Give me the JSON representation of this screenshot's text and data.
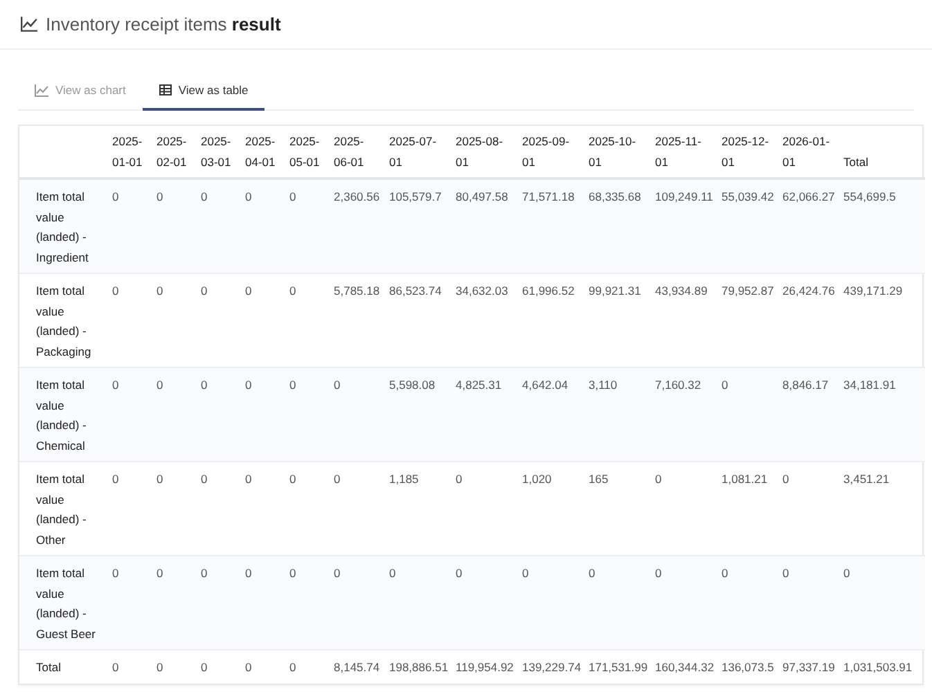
{
  "header": {
    "title": "Inventory receipt items **result**"
  },
  "tabs": [
    {
      "label": "View as chart",
      "kind": "chart",
      "selected": false
    },
    {
      "label": "View as table",
      "kind": "table",
      "selected": true
    }
  ],
  "table": {
    "columns": [
      "2025-01-01",
      "2025-02-01",
      "2025-03-01",
      "2025-04-01",
      "2025-05-01",
      "2025-06-01",
      "2025-07-01",
      "2025-08-01",
      "2025-09-01",
      "2025-10-01",
      "2025-11-01",
      "2025-12-01",
      "2026-01-01",
      "Total"
    ],
    "rows": [
      {
        "label": "Item total value (landed) - Ingredient",
        "values": [
          "0",
          "0",
          "0",
          "0",
          "0",
          "2,360.56",
          "105,579.7",
          "80,497.58",
          "71,571.18",
          "68,335.68",
          "109,249.11",
          "55,039.42",
          "62,066.27",
          "554,699.5"
        ]
      },
      {
        "label": "Item total value (landed) - Packaging",
        "values": [
          "0",
          "0",
          "0",
          "0",
          "0",
          "5,785.18",
          "86,523.74",
          "34,632.03",
          "61,996.52",
          "99,921.31",
          "43,934.89",
          "79,952.87",
          "26,424.76",
          "439,171.29"
        ]
      },
      {
        "label": "Item total value (landed) - Chemical",
        "values": [
          "0",
          "0",
          "0",
          "0",
          "0",
          "0",
          "5,598.08",
          "4,825.31",
          "4,642.04",
          "3,110",
          "7,160.32",
          "0",
          "8,846.17",
          "34,181.91"
        ]
      },
      {
        "label": "Item total value (landed) - Other",
        "values": [
          "0",
          "0",
          "0",
          "0",
          "0",
          "0",
          "1,185",
          "0",
          "1,020",
          "165",
          "0",
          "1,081.21",
          "0",
          "3,451.21"
        ]
      },
      {
        "label": "Item total value (landed) - Guest Beer",
        "values": [
          "0",
          "0",
          "0",
          "0",
          "0",
          "0",
          "0",
          "0",
          "0",
          "0",
          "0",
          "0",
          "0",
          "0"
        ]
      },
      {
        "label": "Total",
        "values": [
          "0",
          "0",
          "0",
          "0",
          "0",
          "8,145.74",
          "198,886.51",
          "119,954.92",
          "139,229.74",
          "171,531.99",
          "160,344.32",
          "136,073.5",
          "97,337.19",
          "1,031,503.91"
        ]
      }
    ]
  }
}
